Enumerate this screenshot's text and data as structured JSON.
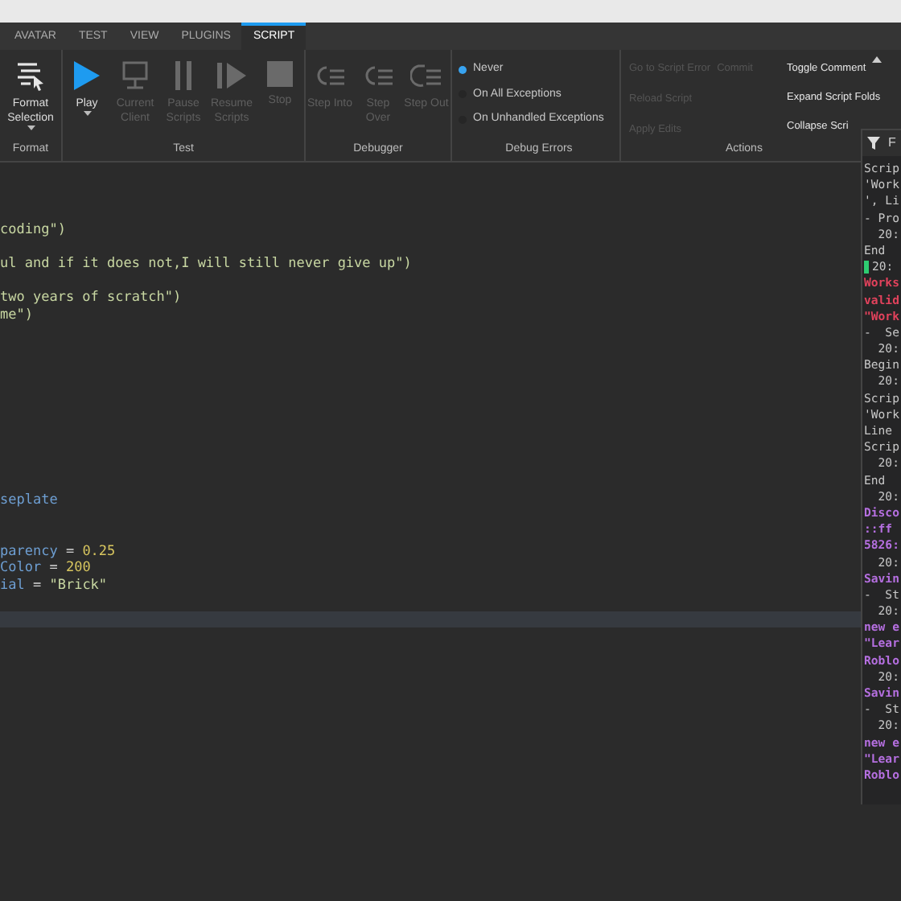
{
  "tabs": [
    {
      "label": "AVATAR",
      "selected": false
    },
    {
      "label": "TEST",
      "selected": false
    },
    {
      "label": "VIEW",
      "selected": false
    },
    {
      "label": "PLUGINS",
      "selected": false
    },
    {
      "label": "SCRIPT",
      "selected": true
    }
  ],
  "ribbon": {
    "groups": [
      {
        "label": "Format",
        "buttons": [
          {
            "kind": "format",
            "label": "Format Selection",
            "dropdown": true,
            "disabled": false
          }
        ]
      },
      {
        "label": "Test",
        "buttons": [
          {
            "kind": "play",
            "label": "Play",
            "dropdown": true,
            "disabled": false
          },
          {
            "kind": "monitor",
            "label": "Current Client",
            "dropdown": false,
            "disabled": true
          },
          {
            "kind": "pause",
            "label": "Pause Scripts",
            "dropdown": false,
            "disabled": true
          },
          {
            "kind": "resume",
            "label": "Resume Scripts",
            "dropdown": false,
            "disabled": true
          },
          {
            "kind": "stop",
            "label": "Stop",
            "dropdown": false,
            "disabled": true
          }
        ]
      },
      {
        "label": "Debugger",
        "buttons": [
          {
            "kind": "step-into",
            "label": "Step Into",
            "dropdown": false,
            "disabled": true
          },
          {
            "kind": "step-over",
            "label": "Step Over",
            "dropdown": false,
            "disabled": true
          },
          {
            "kind": "step-out",
            "label": "Step Out",
            "dropdown": false,
            "disabled": true
          }
        ]
      }
    ],
    "debug_errors": {
      "label": "Debug Errors",
      "options": [
        {
          "label": "Never",
          "selected": true
        },
        {
          "label": "On All Exceptions",
          "selected": false
        },
        {
          "label": "On Unhandled Exceptions",
          "selected": false
        }
      ]
    },
    "actions": {
      "label": "Actions",
      "rows": [
        [
          {
            "label": "Go to Script Error",
            "disabled": true
          },
          {
            "label": "Commit",
            "disabled": true
          }
        ],
        [
          {
            "label": "Reload Script",
            "disabled": true
          }
        ],
        [
          {
            "label": "Apply Edits",
            "disabled": true
          }
        ]
      ],
      "commands": [
        {
          "label": "Toggle Comment",
          "disabled": false
        },
        {
          "label": "Expand Script Folds",
          "disabled": false
        },
        {
          "label": "Collapse Scri",
          "disabled": false
        }
      ]
    }
  },
  "editor": {
    "lines": [
      {
        "tokens": [
          {
            "text": "coding\")",
            "kind": "string"
          }
        ],
        "current": false
      },
      {
        "blank": true,
        "current": false
      },
      {
        "tokens": [
          {
            "text": "ul and if it does not,I will still never give up\")",
            "kind": "string"
          }
        ],
        "current": false
      },
      {
        "blank": true,
        "current": false
      },
      {
        "tokens": [
          {
            "text": "two years of scratch\")",
            "kind": "string"
          }
        ],
        "current": false
      },
      {
        "tokens": [
          {
            "text": "me\")",
            "kind": "string"
          }
        ],
        "current": false
      },
      {
        "blank": true,
        "current": false
      },
      {
        "blank": true,
        "current": false
      },
      {
        "blank": true,
        "current": false
      },
      {
        "blank": true,
        "current": false
      },
      {
        "blank": true,
        "current": false
      },
      {
        "blank": true,
        "current": false
      },
      {
        "blank": true,
        "current": false
      },
      {
        "blank": true,
        "current": false
      },
      {
        "blank": true,
        "current": false
      },
      {
        "blank": true,
        "current": false
      },
      {
        "tokens": [
          {
            "text": "seplate",
            "kind": "name"
          }
        ],
        "current": false
      },
      {
        "blank": true,
        "current": false
      },
      {
        "blank": true,
        "current": false
      },
      {
        "tokens": [
          {
            "text": "parency",
            "kind": "name"
          },
          {
            "text": " = ",
            "kind": "op"
          },
          {
            "text": "0.25",
            "kind": "number"
          }
        ],
        "current": false
      },
      {
        "tokens": [
          {
            "text": "Color",
            "kind": "name"
          },
          {
            "text": " = ",
            "kind": "op"
          },
          {
            "text": "200",
            "kind": "number"
          }
        ],
        "current": false
      },
      {
        "tokens": [
          {
            "text": "ial",
            "kind": "name"
          },
          {
            "text": " = ",
            "kind": "op"
          },
          {
            "text": "\"Brick\"",
            "kind": "string"
          }
        ],
        "current": false
      },
      {
        "blank": true,
        "current": false
      },
      {
        "blank": true,
        "current": true
      }
    ]
  },
  "output": {
    "header": "F",
    "lines": [
      {
        "text": "Scrip",
        "kind": "plain"
      },
      {
        "text": "'Work",
        "kind": "plain"
      },
      {
        "text": "', Li",
        "kind": "plain"
      },
      {
        "text": "- Pro",
        "kind": "plain"
      },
      {
        "text": "  20:",
        "kind": "plain"
      },
      {
        "text": "End",
        "kind": "plain"
      },
      {
        "text": "20:",
        "kind": "marked"
      },
      {
        "text": "Works",
        "kind": "error"
      },
      {
        "text": "valid",
        "kind": "error"
      },
      {
        "text": "\"Work",
        "kind": "error"
      },
      {
        "text": "-  Se",
        "kind": "plain"
      },
      {
        "text": "  20:",
        "kind": "plain"
      },
      {
        "text": "Begin",
        "kind": "plain"
      },
      {
        "text": "  20:",
        "kind": "plain"
      },
      {
        "text": "Scrip",
        "kind": "plain"
      },
      {
        "text": "'Work",
        "kind": "plain"
      },
      {
        "text": "Line",
        "kind": "plain"
      },
      {
        "text": "Scrip",
        "kind": "plain"
      },
      {
        "text": "  20:",
        "kind": "plain"
      },
      {
        "text": "End",
        "kind": "plain"
      },
      {
        "text": "  20:",
        "kind": "plain"
      },
      {
        "text": "Disco",
        "kind": "info"
      },
      {
        "text": "::ff",
        "kind": "info"
      },
      {
        "text": "5826:",
        "kind": "info"
      },
      {
        "text": "  20:",
        "kind": "plain"
      },
      {
        "text": "Savin",
        "kind": "info"
      },
      {
        "text": "-  St",
        "kind": "plain"
      },
      {
        "text": "  20:",
        "kind": "plain"
      },
      {
        "text": "new e",
        "kind": "info"
      },
      {
        "text": "\"Lear",
        "kind": "info"
      },
      {
        "text": "Roblo",
        "kind": "info"
      },
      {
        "text": "  20:",
        "kind": "plain"
      },
      {
        "text": "Savin",
        "kind": "info"
      },
      {
        "text": "-  St",
        "kind": "plain"
      },
      {
        "text": "  20:",
        "kind": "plain"
      },
      {
        "text": "new e",
        "kind": "info"
      },
      {
        "text": "\"Lear",
        "kind": "info"
      },
      {
        "text": "Roblo",
        "kind": "info"
      }
    ]
  }
}
